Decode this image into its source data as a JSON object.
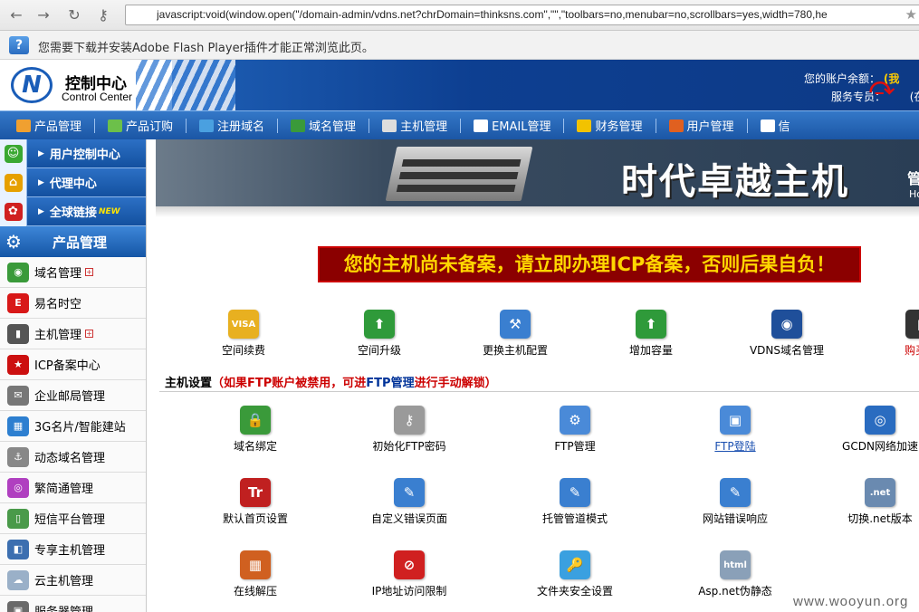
{
  "browser": {
    "url": "javascript:void(window.open(\"/domain-admin/vdns.net?chrDomain=thinksns.com\",\"\",\"toolbars=no,menubar=no,scrollbars=yes,width=780,he",
    "flash_notice": "您需要下载并安装Adobe Flash Player插件才能正常浏览此页。",
    "back_icon": "arrow-left-icon",
    "forward_icon": "arrow-right-icon",
    "reload_icon": "reload-icon",
    "key_icon": "key-icon",
    "star_icon": "star-icon"
  },
  "header": {
    "logo_title": "控制中心",
    "logo_subtitle": "Control Center",
    "account_line1": "您的账户余额：",
    "account_line1_highlight": "(我",
    "account_line2": "服务专员：",
    "account_line2_tail": "(在"
  },
  "topmenu": [
    {
      "label": "产品管理",
      "color": "#f0a030"
    },
    {
      "label": "产品订购",
      "color": "#6cc04a"
    },
    {
      "label": "注册域名",
      "color": "#4aa0e0"
    },
    {
      "label": "域名管理",
      "color": "#3a9a3a"
    },
    {
      "label": "主机管理",
      "color": "#dddddd"
    },
    {
      "label": "EMAIL管理",
      "color": "#ffffff"
    },
    {
      "label": "财务管理",
      "color": "#f2c200"
    },
    {
      "label": "用户管理",
      "color": "#e06020"
    },
    {
      "label": "信",
      "color": "#ffffff"
    }
  ],
  "sidebar": {
    "top_items": [
      {
        "label": "用户控制中心",
        "icon": "user-icon",
        "color": "#3aa832"
      },
      {
        "label": "代理中心",
        "icon": "home-icon",
        "color": "#e6a000"
      },
      {
        "label": "全球链接",
        "icon": "globe-link-icon",
        "color": "#d02020",
        "badge": "NEW"
      }
    ],
    "section_title": "产品管理",
    "items": [
      {
        "label": "域名管理",
        "color": "#3a9a3a",
        "glyph": "◉",
        "plus": true
      },
      {
        "label": "易名时空",
        "color": "#d81818",
        "glyph": "E",
        "plus": false
      },
      {
        "label": "主机管理",
        "color": "#555555",
        "glyph": "▮",
        "plus": true
      },
      {
        "label": "ICP备案中心",
        "color": "#cc1010",
        "glyph": "★",
        "plus": false
      },
      {
        "label": "企业邮局管理",
        "color": "#777777",
        "glyph": "✉",
        "plus": false
      },
      {
        "label": "3G名片/智能建站",
        "color": "#2d7fd0",
        "glyph": "▦",
        "plus": false
      },
      {
        "label": "动态域名管理",
        "color": "#888888",
        "glyph": "⚓",
        "plus": false
      },
      {
        "label": "繁简通管理",
        "color": "#b040c0",
        "glyph": "◎",
        "plus": false
      },
      {
        "label": "短信平台管理",
        "color": "#4a9a4a",
        "glyph": "▯",
        "plus": false
      },
      {
        "label": "专享主机管理",
        "color": "#3c6fb0",
        "glyph": "◧",
        "plus": false
      },
      {
        "label": "云主机管理",
        "color": "#9ab0c8",
        "glyph": "☁",
        "plus": false
      },
      {
        "label": "服务器管理",
        "color": "#6a6a6a",
        "glyph": "▣",
        "plus": false
      }
    ]
  },
  "banner": {
    "title": "时代卓越主机",
    "right_text1": "管",
    "right_text2": "Ho"
  },
  "warning_text": "您的主机尚未备案，请立即办理ICP备案，否则后果自负！",
  "row1": [
    {
      "label": "空间续费",
      "icon": "visa-card-icon",
      "color": "#e8b020",
      "glyph": "VISA",
      "style": ""
    },
    {
      "label": "空间升级",
      "icon": "upgrade-arrow-icon",
      "color": "#2f9a3a",
      "glyph": "⬆",
      "style": ""
    },
    {
      "label": "更换主机配置",
      "icon": "config-tools-icon",
      "color": "#3a7fd0",
      "glyph": "⚒",
      "style": ""
    },
    {
      "label": "增加容量",
      "icon": "add-capacity-icon",
      "color": "#2f9a3a",
      "glyph": "⬆",
      "style": ""
    },
    {
      "label": "VDNS域名管理",
      "icon": "vdns-icon",
      "color": "#1f4f9a",
      "glyph": "◉",
      "style": ""
    },
    {
      "label": "购买独",
      "icon": "buy-server-icon",
      "color": "#333333",
      "glyph": "▮",
      "style": "red"
    }
  ],
  "settings": {
    "title": "主机设置",
    "note_part1": "（如果FTP账户被禁用，可进",
    "note_link": "FTP管理",
    "note_part2": "进行手动解锁）"
  },
  "row2": [
    {
      "label": "域名绑定",
      "icon": "domain-bind-icon",
      "color": "#3a9a3a",
      "glyph": "🔒",
      "style": ""
    },
    {
      "label": "初始化FTP密码",
      "icon": "ftp-password-key-icon",
      "color": "#9a9a9a",
      "glyph": "⚷",
      "style": ""
    },
    {
      "label": "FTP管理",
      "icon": "ftp-manage-icon",
      "color": "#4a8ad8",
      "glyph": "⚙",
      "style": ""
    },
    {
      "label": "FTP登陆",
      "icon": "ftp-login-icon",
      "color": "#4a8ad8",
      "glyph": "▣",
      "style": "link"
    },
    {
      "label": "GCDN网络加速",
      "icon": "gcdn-global-icon",
      "color": "#2a6cc0",
      "glyph": "◎",
      "style": ""
    }
  ],
  "row3": [
    {
      "label": "默认首页设置",
      "icon": "default-page-icon",
      "color": "#c02020",
      "glyph": "Tr",
      "style": ""
    },
    {
      "label": "自定义错误页面",
      "icon": "custom-error-icon",
      "color": "#3a7fd0",
      "glyph": "✎",
      "style": ""
    },
    {
      "label": "托管管道模式",
      "icon": "pipeline-mode-icon",
      "color": "#3a7fd0",
      "glyph": "✎",
      "style": ""
    },
    {
      "label": "网站错误响应",
      "icon": "error-response-icon",
      "color": "#3a7fd0",
      "glyph": "✎",
      "style": ""
    },
    {
      "label": "切换.net版本",
      "icon": "dotnet-switch-icon",
      "color": "#6a8ab0",
      "glyph": ".net",
      "style": ""
    }
  ],
  "row4": [
    {
      "label": "在线解压",
      "icon": "unzip-icon",
      "color": "#d06020",
      "glyph": "▦",
      "style": ""
    },
    {
      "label": "IP地址访问限制",
      "icon": "ip-block-icon",
      "color": "#d02020",
      "glyph": "⊘",
      "style": ""
    },
    {
      "label": "文件夹安全设置",
      "icon": "folder-security-icon",
      "color": "#3aa0e0",
      "glyph": "🔑",
      "style": ""
    },
    {
      "label": "Asp.net伪静态",
      "icon": "aspnet-rewrite-icon",
      "color": "#8aa0b8",
      "glyph": "html",
      "style": ""
    }
  ],
  "watermark": "www.wooyun.org"
}
